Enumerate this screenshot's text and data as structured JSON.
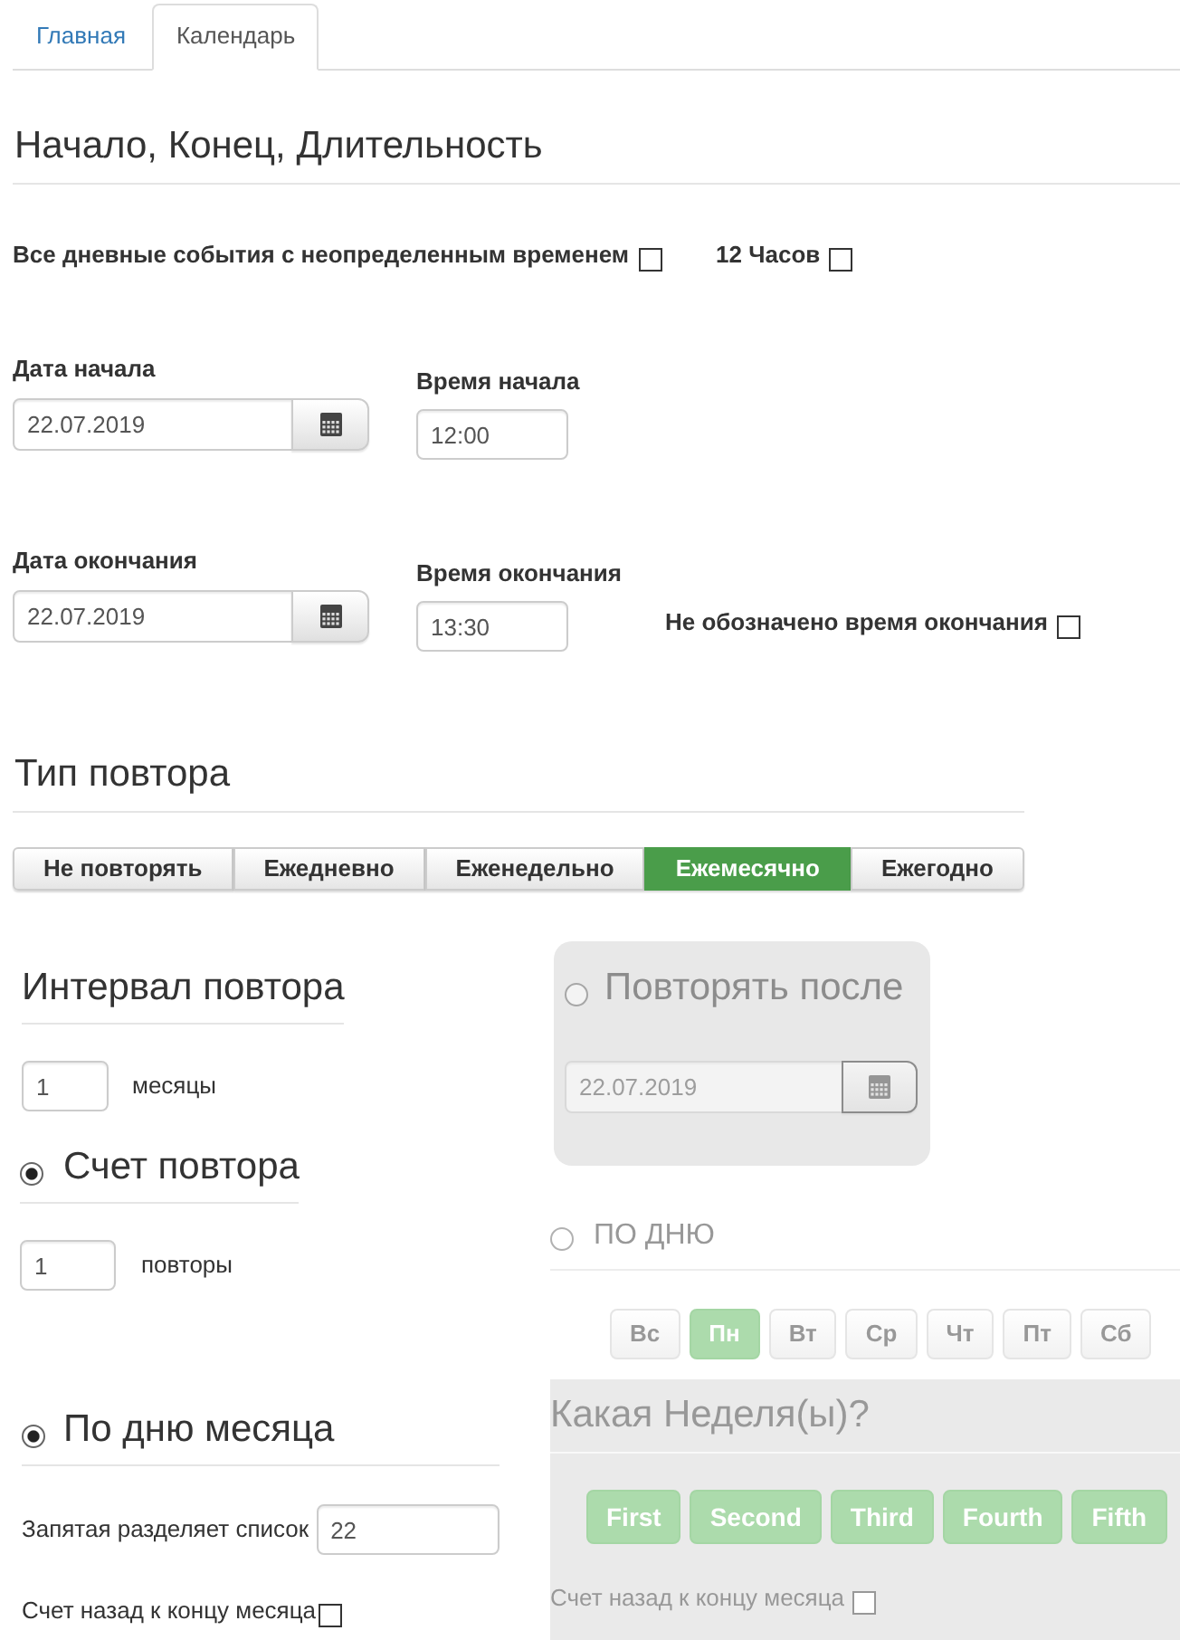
{
  "tabs": [
    {
      "label": "Главная",
      "selected": false
    },
    {
      "label": "Календарь",
      "selected": true
    }
  ],
  "timing": {
    "title": "Начало, Конец, Длительность",
    "options": [
      {
        "label": "Все дневные события с неопределенным временем",
        "checked": false
      },
      {
        "label": "12 Часов",
        "checked": false
      }
    ],
    "start": {
      "date_label": "Дата начала",
      "date": "22.07.2019",
      "time_label": "Время начала",
      "time": "12:00"
    },
    "end": {
      "date_label": "Дата окончания",
      "date": "22.07.2019",
      "time_label": "Время окончания",
      "time": "13:30"
    },
    "no_end_time": {
      "label": "Не обозначено время окончания",
      "checked": false
    }
  },
  "repeat_type": {
    "title": "Тип повтора",
    "options": [
      {
        "label": "Не повторять",
        "selected": false
      },
      {
        "label": "Ежедневно",
        "selected": false
      },
      {
        "label": "Еженедельно",
        "selected": false
      },
      {
        "label": "Ежемесячно",
        "selected": true
      },
      {
        "label": "Ежегодно",
        "selected": false
      }
    ]
  },
  "interval": {
    "title": "Интервал повтора",
    "value": "1",
    "unit": "месяцы"
  },
  "count": {
    "title": "Счет повтора",
    "selected": true,
    "value": "1",
    "unit": "повторы"
  },
  "until": {
    "title": "Повторять после",
    "selected": false,
    "disabled": true,
    "date": "22.07.2019"
  },
  "month_day": {
    "title": "По дню месяца",
    "selected": true,
    "list_label": "Запятая разделяет список",
    "list_value": "22",
    "count_back": {
      "label": "Счет назад к концу месяца",
      "checked": false
    }
  },
  "weekday": {
    "title": "ПО ДНЮ",
    "selected": false,
    "disabled": true,
    "days": [
      {
        "label": "Вс",
        "selected": false
      },
      {
        "label": "Пн",
        "selected": true
      },
      {
        "label": "Вт",
        "selected": false
      },
      {
        "label": "Ср",
        "selected": false
      },
      {
        "label": "Чт",
        "selected": false
      },
      {
        "label": "Пт",
        "selected": false
      },
      {
        "label": "Сб",
        "selected": false
      }
    ],
    "weeks_title": "Какая Неделя(ы)?",
    "weeks": [
      {
        "label": "First",
        "selected": true
      },
      {
        "label": "Second",
        "selected": true
      },
      {
        "label": "Third",
        "selected": true
      },
      {
        "label": "Fourth",
        "selected": true
      },
      {
        "label": "Fifth",
        "selected": true
      }
    ],
    "count_back": {
      "label": "Счет назад к концу месяца",
      "checked": false
    }
  }
}
